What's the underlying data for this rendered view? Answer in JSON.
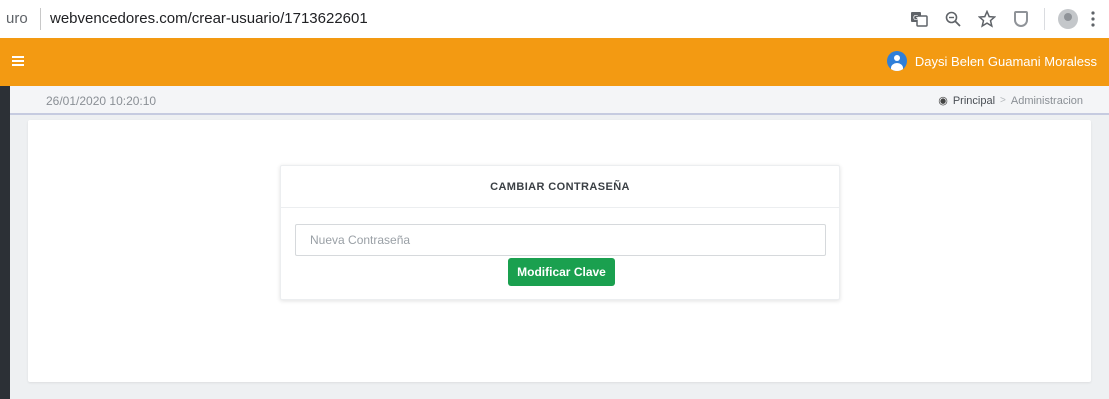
{
  "browser": {
    "url_prefix": "uro",
    "url": "webvencedores.com/crear-usuario/1713622601",
    "icons": [
      "translate-icon",
      "zoom-icon",
      "star-icon",
      "shield-extension-icon",
      "profile-icon",
      "menu-dots-icon"
    ]
  },
  "header": {
    "accent_color": "#f39a12",
    "user_name": "Daysi Belen Guamani Moraless"
  },
  "subbar": {
    "datetime": "26/01/2020 10:20:10",
    "breadcrumb": {
      "home": "Principal",
      "separator": ">",
      "current": "Administracion"
    }
  },
  "card": {
    "title": "CAMBIAR CONTRASEÑA",
    "password_placeholder": "Nueva Contraseña",
    "password_value": "",
    "submit_label": "Modificar Clave",
    "button_color": "#1aa04f"
  }
}
